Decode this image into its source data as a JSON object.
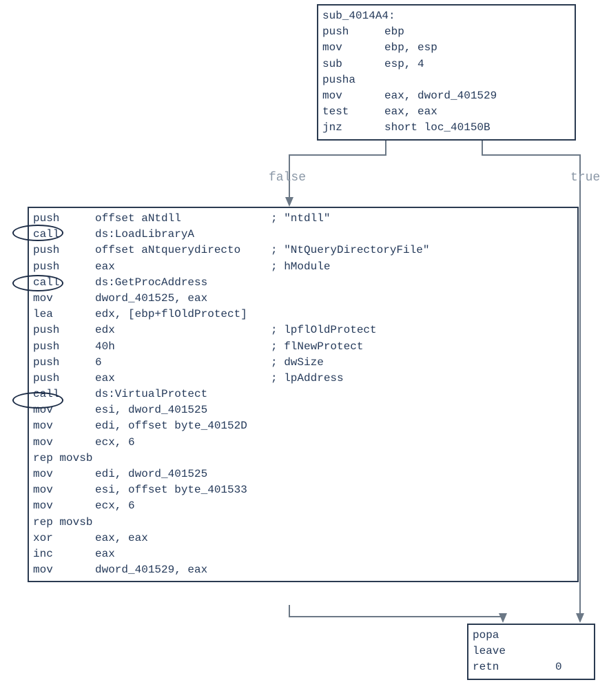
{
  "block1": {
    "label": "sub_4014A4:",
    "lines": [
      {
        "m": "push",
        "op": "ebp"
      },
      {
        "m": "mov",
        "op": "ebp, esp"
      },
      {
        "m": "sub",
        "op": "esp, 4"
      },
      {
        "m": "pusha",
        "op": ""
      },
      {
        "m": "mov",
        "op": "eax, dword_401529"
      },
      {
        "m": "test",
        "op": "eax, eax"
      },
      {
        "m": "jnz",
        "op": "short loc_40150B"
      }
    ]
  },
  "edges": {
    "false_label": "false",
    "true_label": "true"
  },
  "block2": {
    "lines": [
      {
        "m": "push",
        "op": "offset aNtdll",
        "c": "; \"ntdll\""
      },
      {
        "m": "call",
        "op": "ds:LoadLibraryA"
      },
      {
        "m": "push",
        "op": "offset aNtquerydirecto",
        "c": "; \"NtQueryDirectoryFile\""
      },
      {
        "m": "push",
        "op": "eax",
        "c": "; hModule"
      },
      {
        "m": "call",
        "op": "ds:GetProcAddress"
      },
      {
        "m": "mov",
        "op": "dword_401525, eax"
      },
      {
        "m": "lea",
        "op": "edx, [ebp+flOldProtect]"
      },
      {
        "m": "push",
        "op": "edx",
        "c": "; lpflOldProtect"
      },
      {
        "m": "push",
        "op": "40h",
        "c": "; flNewProtect"
      },
      {
        "m": "push",
        "op": "6",
        "c": "; dwSize"
      },
      {
        "m": "push",
        "op": "eax",
        "c": "; lpAddress"
      },
      {
        "m": "call",
        "op": "ds:VirtualProtect"
      },
      {
        "m": "mov",
        "op": "esi, dword_401525"
      },
      {
        "m": "mov",
        "op": "edi, offset byte_40152D"
      },
      {
        "m": "mov",
        "op": "ecx, 6"
      },
      {
        "m": "rep movsb",
        "op": ""
      },
      {
        "m": "mov",
        "op": "edi, dword_401525"
      },
      {
        "m": "mov",
        "op": "esi, offset byte_401533"
      },
      {
        "m": "mov",
        "op": "ecx, 6"
      },
      {
        "m": "rep movsb",
        "op": ""
      },
      {
        "m": "xor",
        "op": "eax, eax"
      },
      {
        "m": "inc",
        "op": "eax"
      },
      {
        "m": "mov",
        "op": "dword_401529, eax"
      }
    ]
  },
  "block3": {
    "lines": [
      {
        "m": "popa",
        "op": ""
      },
      {
        "m": "leave",
        "op": ""
      },
      {
        "m": "retn",
        "op": "0",
        "align": true
      }
    ]
  },
  "annotations": {
    "call_highlight": [
      "call",
      "call",
      "call"
    ]
  },
  "chart_data": {
    "type": "diagram",
    "nodes": [
      {
        "id": "sub_4014A4",
        "label": "sub_4014A4:",
        "content": "push ebp; mov ebp, esp; sub esp, 4; pusha; mov eax, dword_401529; test eax, eax; jnz short loc_40150B"
      },
      {
        "id": "false_block",
        "label": "",
        "content": "push offset aNtdll ; \"ntdll\"; call ds:LoadLibraryA; push offset aNtquerydirecto ; \"NtQueryDirectoryFile\"; push eax ; hModule; call ds:GetProcAddress; mov dword_401525, eax; lea edx, [ebp+flOldProtect]; push edx ; lpflOldProtect; push 40h ; flNewProtect; push 6 ; dwSize; push eax ; lpAddress; call ds:VirtualProtect; mov esi, dword_401525; mov edi, offset byte_40152D; mov ecx, 6; rep movsb; mov edi, dword_401525; mov esi, offset byte_401533; mov ecx, 6; rep movsb; xor eax, eax; inc eax; mov dword_401529, eax"
      },
      {
        "id": "loc_40150B",
        "label": "",
        "content": "popa; leave; retn 0"
      }
    ],
    "edges": [
      {
        "from": "sub_4014A4",
        "to": "false_block",
        "label": "false"
      },
      {
        "from": "sub_4014A4",
        "to": "loc_40150B",
        "label": "true"
      },
      {
        "from": "false_block",
        "to": "loc_40150B",
        "label": ""
      }
    ],
    "annotations_circled": [
      "call ds:LoadLibraryA",
      "call ds:GetProcAddress",
      "call ds:VirtualProtect"
    ]
  }
}
